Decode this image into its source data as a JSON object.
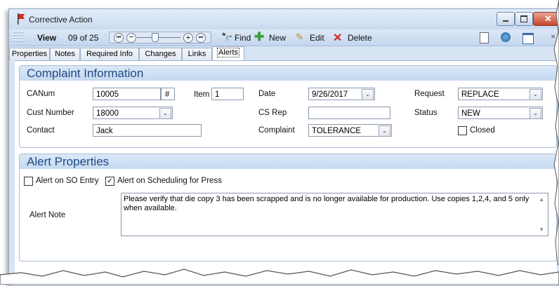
{
  "window": {
    "title": "Corrective Action"
  },
  "toolbar": {
    "view_label": "View",
    "record_position": "09 of 25",
    "find_label": "Find",
    "new_label": "New",
    "edit_label": "Edit",
    "delete_label": "Delete"
  },
  "tabs": [
    {
      "label": "Properties"
    },
    {
      "label": "Notes"
    },
    {
      "label": "Required Info"
    },
    {
      "label": "Changes"
    },
    {
      "label": "Links"
    },
    {
      "label": "Alerts",
      "active": true
    }
  ],
  "complaint": {
    "header": "Complaint Information",
    "canum_label": "CANum",
    "canum_value": "10005",
    "hash_label": "#",
    "item_label": "Item",
    "item_value": "1",
    "date_label": "Date",
    "date_value": "9/26/2017",
    "request_label": "Request",
    "request_value": "REPLACE",
    "cust_label": "Cust Number",
    "cust_value": "18000",
    "csrep_label": "CS Rep",
    "csrep_value": "",
    "status_label": "Status",
    "status_value": "NEW",
    "contact_label": "Contact",
    "contact_value": "Jack",
    "complaint_label": "Complaint",
    "complaint_value": "TOLERANCE",
    "closed_label": "Closed",
    "closed_checked": false
  },
  "alerts": {
    "header": "Alert Properties",
    "so_entry_label": "Alert on SO Entry",
    "so_entry_checked": false,
    "scheduling_label": "Alert on Scheduling for Press",
    "scheduling_checked": true,
    "note_label": "Alert Note",
    "note_text": "Please verify that die copy 3 has been scrapped and is no longer available for production. Use copies 1,2,4, and 5 only when available."
  },
  "colors": {
    "accent": "#1f4a86",
    "header_bg": "#c6d9f0",
    "window_bg": "#d6e4f4",
    "delete_red": "#d6221a",
    "new_green": "#3ea33a"
  }
}
